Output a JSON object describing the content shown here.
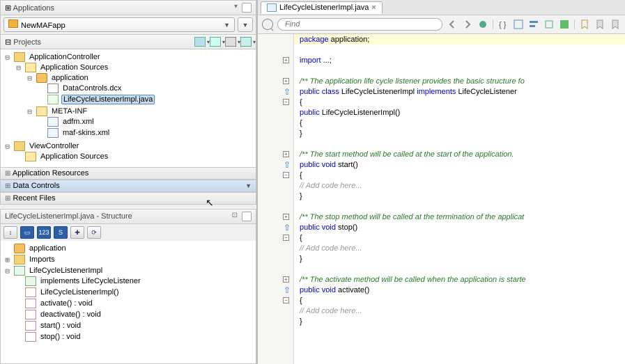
{
  "left": {
    "applications": {
      "title": "Applications"
    },
    "appDropdown": {
      "value": "NewMAFapp"
    },
    "projects": {
      "title": "Projects"
    },
    "tree": {
      "appController": "ApplicationController",
      "appSources": "Application Sources",
      "pkg": "application",
      "dcx": "DataControls.dcx",
      "selected": "LifeCycleListenerImpl.java",
      "meta": "META-INF",
      "adfm": "adfm.xml",
      "skins": "maf-skins.xml",
      "viewCtrl": "ViewController",
      "vcAppSources": "Application Sources"
    },
    "appRes": "Application Resources",
    "dataCtrls": "Data Controls",
    "recent": "Recent Files",
    "structure": {
      "title": "LifeCycleListenerImpl.java - Structure",
      "pkg": "application",
      "imports": "Imports",
      "cls": "LifeCycleListenerImpl",
      "impl": "implements LifeCycleListener",
      "ctor": "LifeCycleListenerImpl()",
      "m1": "activate() : void",
      "m2": "deactivate() : void",
      "m3": "start() : void",
      "m4": "stop() : void"
    }
  },
  "editor": {
    "tab": "LifeCycleListenerImpl.java",
    "findPlaceholder": "Find",
    "code": {
      "pkgLine_a": "package",
      "pkgLine_b": " application;",
      "importLine_a": "import",
      "importLine_b": " ...;",
      "jd1": "/** The application life cycle listener provides the basic structure fo",
      "cls_a": "public class ",
      "cls_b": "LifeCycleListenerImpl ",
      "cls_c": "implements ",
      "cls_d": "LifeCycleListener",
      "ob": "{",
      "cb": "}",
      "ctor_a": "public",
      "ctor_b": " LifeCycleListenerImpl()",
      "jd2": "/** The start method will be called at the start of the application.",
      "m1_a": "public void",
      "m1_b": " start()",
      "addCode": "// Add code here...",
      "jd3": "/** The stop method will be called at the termination of the applicat",
      "m2_b": " stop()",
      "jd4": "/** The activate method will be called when the application is starte",
      "m3_b": " activate()"
    }
  }
}
